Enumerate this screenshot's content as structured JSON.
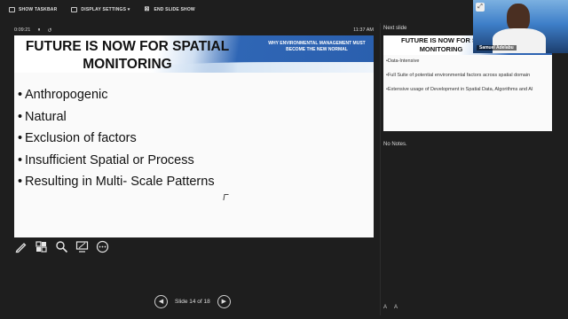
{
  "toolbar": {
    "show_taskbar": "SHOW TASKBAR",
    "display_settings": "DISPLAY SETTINGS ▾",
    "end_slide_show": "END SLIDE SHOW"
  },
  "timer": {
    "elapsed": "0:09:21",
    "pause_glyph": "⏸",
    "reset_glyph": "↺",
    "clock": "11:37 AM"
  },
  "current_slide": {
    "title": "FUTURE IS NOW FOR SPATIAL MONITORING",
    "subtitle": "WHY ENVIRONMENTAL MANAGEMENT MUST BECOME THE NEW NORMAL",
    "bullets": [
      "Anthropogenic",
      "Natural",
      "Exclusion of factors",
      "Insufficient Spatial or Process",
      "Resulting in Multi- Scale Patterns"
    ]
  },
  "tools": [
    "pen-icon",
    "slide-grid-icon",
    "magnifier-icon",
    "screen-toggle-icon",
    "more-options-icon"
  ],
  "navigation": {
    "prev": "◀",
    "next": "▶",
    "counter": "Slide 14 of 18"
  },
  "next_slide": {
    "label": "Next slide",
    "title": "FUTURE IS NOW FOR SP MONITORING",
    "bullets": [
      "Data-Intensive",
      "Full Suite of potential environmental factors across spatial domain",
      "Extensive usage of Development in Spatial Data, Algorithms and AI"
    ]
  },
  "notes": {
    "text": "No Notes."
  },
  "font_controls": {
    "increase": "A",
    "decrease": "A"
  },
  "webcam": {
    "name": "Samuel Adelabu"
  },
  "colors": {
    "banner_blue": "#2a5fae",
    "background": "#1e1e1e"
  }
}
